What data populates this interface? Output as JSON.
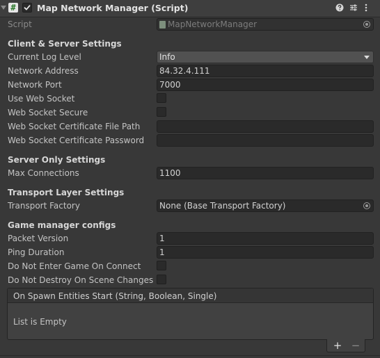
{
  "header": {
    "title": "Map Network Manager (Script)",
    "script_glyph": "#",
    "enabled": true,
    "icons": [
      "help-icon",
      "presets-icon",
      "menu-icon"
    ]
  },
  "script_row": {
    "label": "Script",
    "value": "MapNetworkManager"
  },
  "client_server": {
    "heading": "Client & Server Settings",
    "log_level": {
      "label": "Current Log Level",
      "value": "Info"
    },
    "network_address": {
      "label": "Network Address",
      "value": "84.32.4.111"
    },
    "network_port": {
      "label": "Network Port",
      "value": "7000"
    },
    "use_web_socket": {
      "label": "Use Web Socket",
      "checked": false
    },
    "web_socket_secure": {
      "label": "Web Socket Secure",
      "checked": false
    },
    "cert_file_path": {
      "label": "Web Socket Certificate File Path",
      "value": ""
    },
    "cert_password": {
      "label": "Web Socket Certificate Password",
      "value": ""
    }
  },
  "server_only": {
    "heading": "Server Only Settings",
    "max_connections": {
      "label": "Max Connections",
      "value": "1100"
    }
  },
  "transport": {
    "heading": "Transport Layer Settings",
    "factory": {
      "label": "Transport Factory",
      "value": "None (Base Transport Factory)"
    }
  },
  "game_manager": {
    "heading": "Game manager configs",
    "packet_version": {
      "label": "Packet Version",
      "value": "1"
    },
    "ping_duration": {
      "label": "Ping Duration",
      "value": "1"
    },
    "no_enter_game": {
      "label": "Do Not Enter Game On Connect",
      "checked": false
    },
    "no_destroy": {
      "label": "Do Not Destroy On Scene Changes",
      "checked": false
    }
  },
  "spawn_event": {
    "title": "On Spawn Entities Start (String, Boolean, Single)",
    "empty_text": "List is Empty",
    "add_label": "+",
    "remove_label": "−"
  },
  "colors": {
    "background": "#383838",
    "field": "#2a2a2a",
    "text": "#c4c4c4"
  }
}
